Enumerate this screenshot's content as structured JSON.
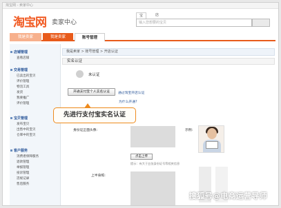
{
  "window": {
    "title": "淘宝网 - 卖家中心"
  },
  "header": {
    "logo_text": "淘宝网",
    "logo_sub": "卖家中心",
    "search_tabs": [
      "宝贝",
      "店铺"
    ],
    "search_placeholder": "输入您想要的宝贝"
  },
  "nav": {
    "tabs": [
      "我是卖家",
      "我是卖家",
      "账号管理"
    ],
    "active_index": 2
  },
  "sidebar": {
    "groups": [
      {
        "label": "店铺管理",
        "items": [
          "查看店铺"
        ]
      },
      {
        "label": "交易管理",
        "items": [
          "已卖出的宝贝",
          "评价管理",
          "物流工具",
          "发货",
          "我要推广",
          "评价管理"
        ]
      },
      {
        "label": "宝贝管理",
        "items": [
          "发布宝贝",
          "出售中的宝贝",
          "仓库中的宝贝"
        ]
      },
      {
        "label": "客户服务",
        "items": [
          "消费者保障服务",
          "退款管理",
          "举报管理",
          "投诉管理",
          "违规记录",
          "售后服务"
        ]
      }
    ]
  },
  "breadcrumb": "我是卖家 > 账号管理 > 开店认证",
  "panel": {
    "title": "实名认证",
    "status": "未认证",
    "verify_button": "开通支付宝个人实名认证",
    "verify_link": "通过淘宝开店认证",
    "why_link": "为什么开通?"
  },
  "callout": "先进行支付宝实名认证",
  "form": {
    "id_label": "身份证正面头像:",
    "sample_label": "示例:",
    "upload_button": "点击上传",
    "hint": "提示：有大于五张身份证号等相关信息",
    "upper_label": "上半身照:"
  },
  "watermark": "搜狐号@电商运营导师",
  "colors": {
    "brand": "#f15a22",
    "accent": "#e85a1a",
    "link": "#2a5699",
    "callout_border": "#ee8a1c"
  }
}
